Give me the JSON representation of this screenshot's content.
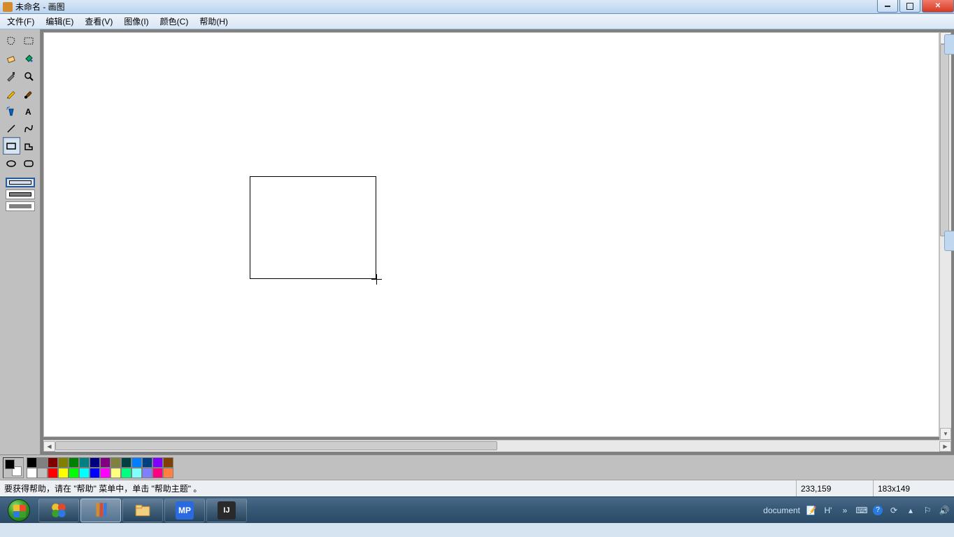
{
  "title": "未命名 - 画图",
  "menus": [
    "文件(F)",
    "编辑(E)",
    "查看(V)",
    "图像(I)",
    "颜色(C)",
    "帮助(H)"
  ],
  "tools": [
    {
      "name": "free-select-icon"
    },
    {
      "name": "rect-select-icon"
    },
    {
      "name": "eraser-icon"
    },
    {
      "name": "fill-icon"
    },
    {
      "name": "picker-icon"
    },
    {
      "name": "magnifier-icon"
    },
    {
      "name": "pencil-icon"
    },
    {
      "name": "brush-icon"
    },
    {
      "name": "airbrush-icon"
    },
    {
      "name": "text-icon"
    },
    {
      "name": "line-icon"
    },
    {
      "name": "curve-icon"
    },
    {
      "name": "rectangle-icon",
      "active": true
    },
    {
      "name": "polygon-icon"
    },
    {
      "name": "ellipse-icon"
    },
    {
      "name": "rounded-rect-icon"
    }
  ],
  "palette_row1": [
    "#000000",
    "#808080",
    "#800000",
    "#808000",
    "#008000",
    "#008080",
    "#000080",
    "#800080",
    "#808040",
    "#004040",
    "#0080ff",
    "#004080",
    "#8000ff",
    "#804000"
  ],
  "palette_row2": [
    "#ffffff",
    "#c0c0c0",
    "#ff0000",
    "#ffff00",
    "#00ff00",
    "#00ffff",
    "#0000ff",
    "#ff00ff",
    "#ffff80",
    "#00ff80",
    "#80ffff",
    "#8080ff",
    "#ff0080",
    "#ff8040"
  ],
  "status_help": "要获得帮助，请在 \"帮助\" 菜单中，单击 \"帮助主题\" 。",
  "status_coords": "233,159",
  "status_size": "183x149",
  "tray_label": "document",
  "tray_ime": "H'",
  "tray_overflow": "»"
}
